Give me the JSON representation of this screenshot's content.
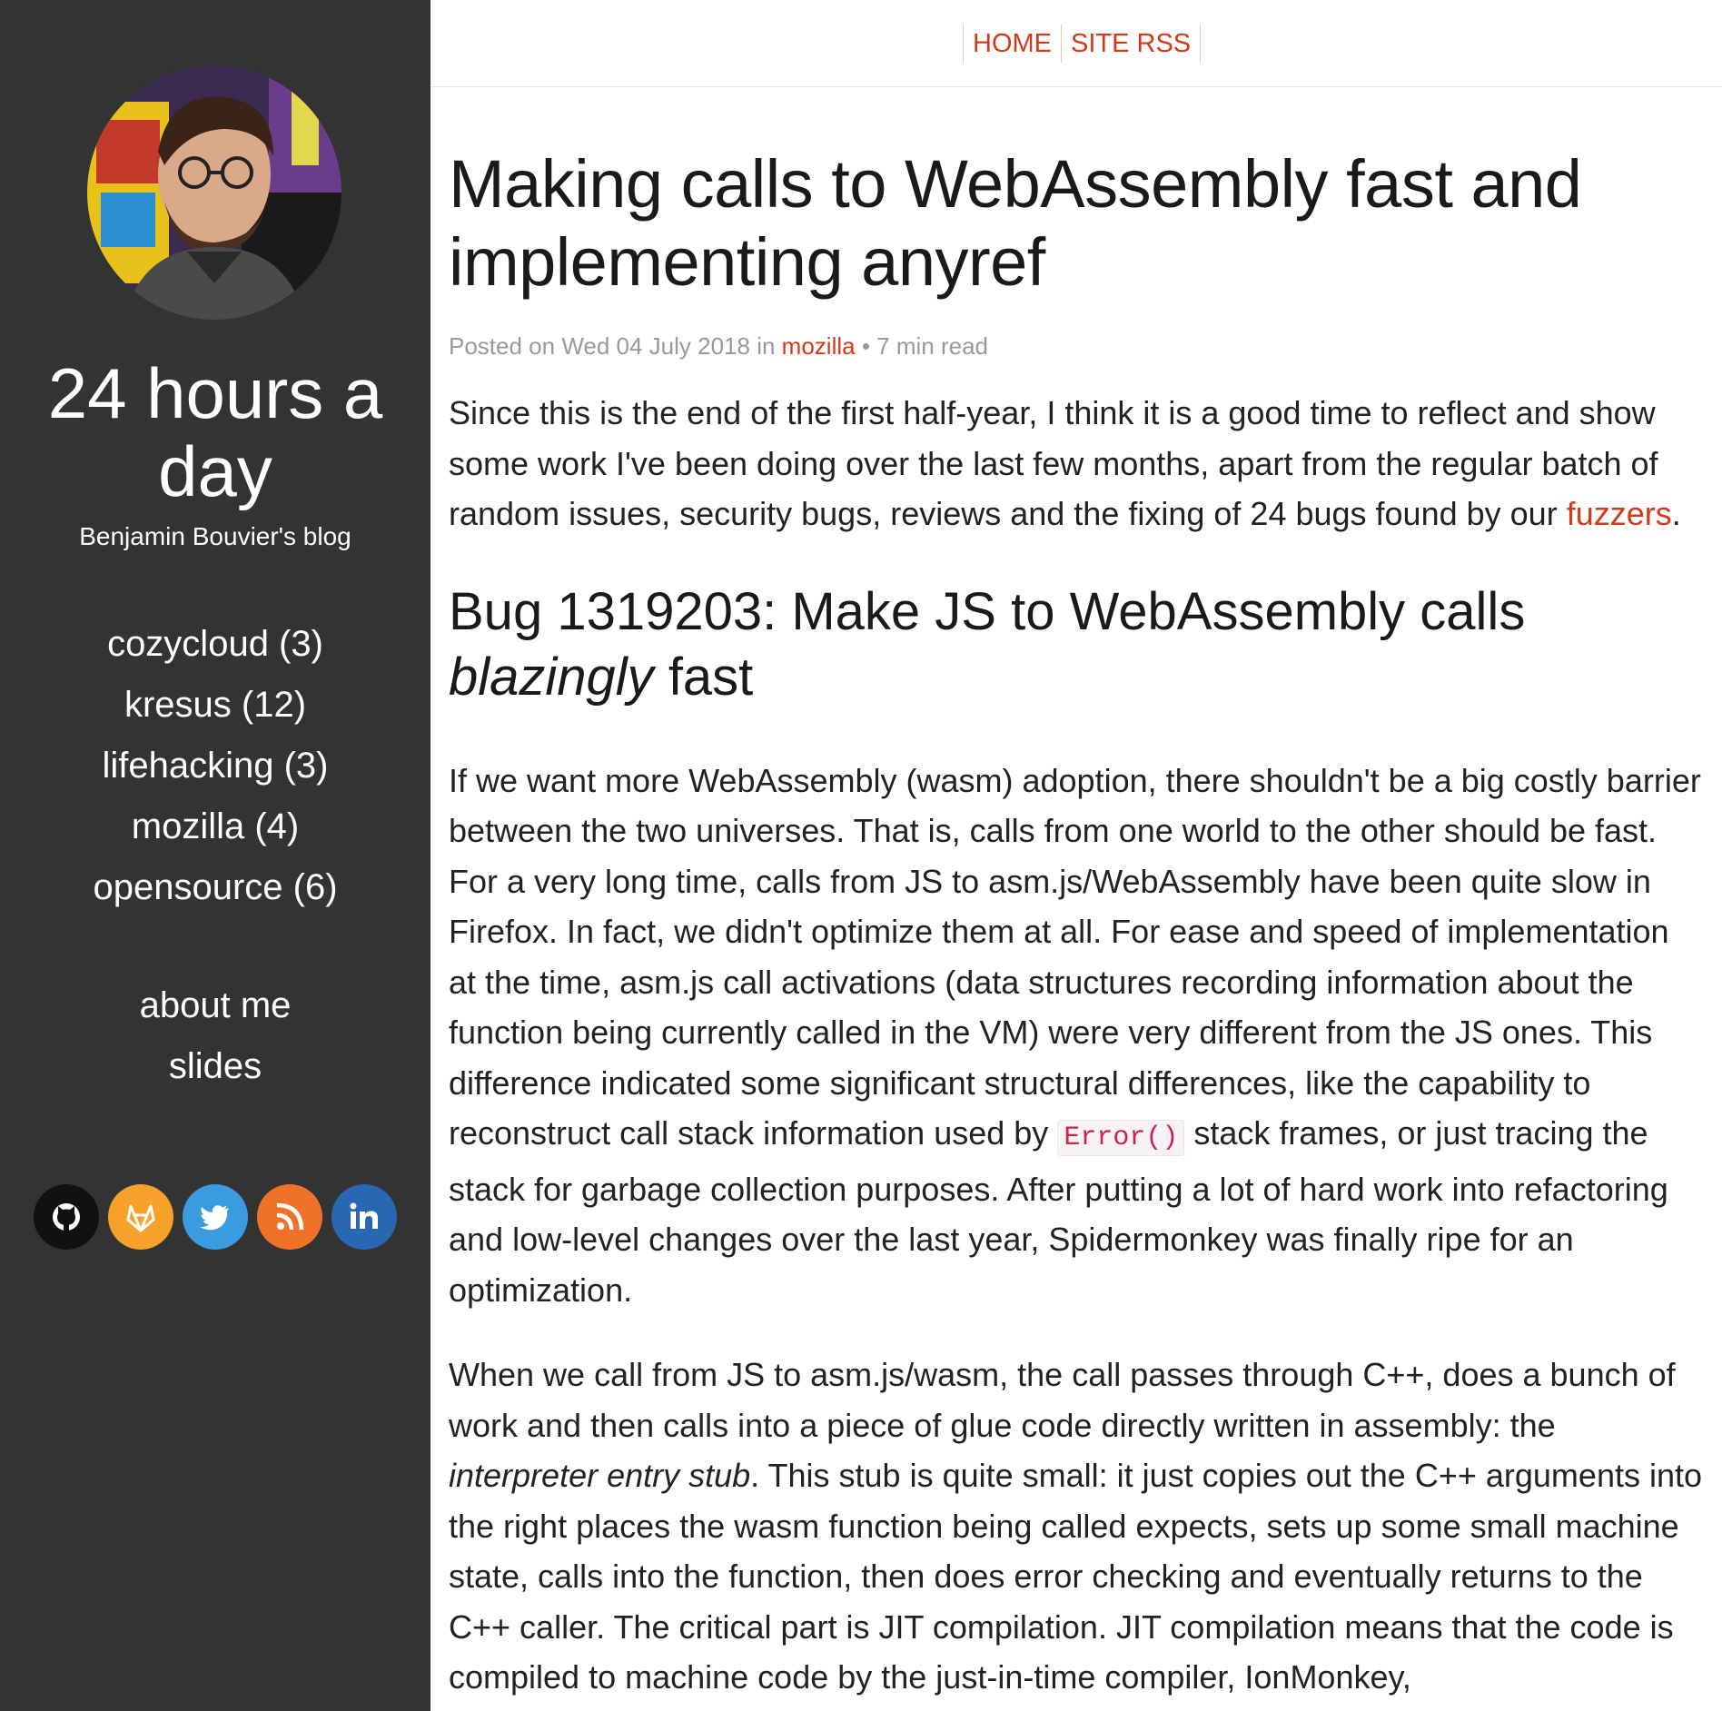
{
  "nav": {
    "home": "HOME",
    "rss": "SITE RSS"
  },
  "sidebar": {
    "title": "24 hours a day",
    "subtitle": "Benjamin Bouvier's blog",
    "categories": [
      {
        "label": "cozycloud (3)"
      },
      {
        "label": "kresus (12)"
      },
      {
        "label": "lifehacking (3)"
      },
      {
        "label": "mozilla (4)"
      },
      {
        "label": "opensource (6)"
      }
    ],
    "links": [
      {
        "label": "about me"
      },
      {
        "label": "slides"
      }
    ],
    "social": [
      {
        "icon": "github-icon",
        "color": "#111111"
      },
      {
        "icon": "gitlab-icon",
        "color": "#f5a12a"
      },
      {
        "icon": "twitter-icon",
        "color": "#3a9be0"
      },
      {
        "icon": "rss-icon",
        "color": "#f0722a"
      },
      {
        "icon": "linkedin-icon",
        "color": "#2867b2"
      }
    ]
  },
  "post": {
    "title": "Making calls to WebAssembly fast and implementing anyref",
    "meta": {
      "prefix": "Posted on Wed 04 July 2018 in",
      "category": "mozilla",
      "read_time": "• 7 min read"
    },
    "p1": {
      "text": "Since this is the end of the first half-year, I think it is a good time to reflect and show some work I've been doing over the last few months, apart from the regular batch of random issues, security bugs, reviews and the fixing of 24 bugs found by our",
      "link": "fuzzers",
      "end": "."
    },
    "heading": {
      "before": "Bug 1319203: Make JS to WebAssembly calls",
      "emph": "blazingly",
      "after": "fast"
    },
    "p2": {
      "before": "If we want more WebAssembly (wasm) adoption, there shouldn't be a big costly barrier between the two universes. That is, calls from one world to the other should be fast. For a very long time, calls from JS to asm.js/WebAssembly have been quite slow in Firefox. In fact, we didn't optimize them at all. For ease and speed of implementation at the time, asm.js call activations (data structures recording information about the function being currently called in the VM) were very different from the JS ones. This difference indicated some significant structural differences, like the capability to reconstruct call stack information used by",
      "code": "Error()",
      "after": "stack frames, or just tracing the stack for garbage collection purposes. After putting a lot of hard work into refactoring and low-level changes over the last year, Spidermonkey was finally ripe for an optimization."
    },
    "p3": {
      "before": "When we call from JS to asm.js/wasm, the call passes through C++, does a bunch of work and then calls into a piece of glue code directly written in assembly: the",
      "emph": "interpreter entry stub",
      "after": ". This stub is quite small: it just copies out the C++ arguments into the right places the wasm function being called expects, sets up some small machine state, calls into the function, then does error checking and eventually returns to the C++ caller. The critical part is JIT compilation. JIT compilation means that the code is compiled to machine code by the just-in-time compiler, IonMonkey,"
    }
  },
  "colors": {
    "sidebar_bg": "#333333",
    "accent": "#d43a1a"
  }
}
